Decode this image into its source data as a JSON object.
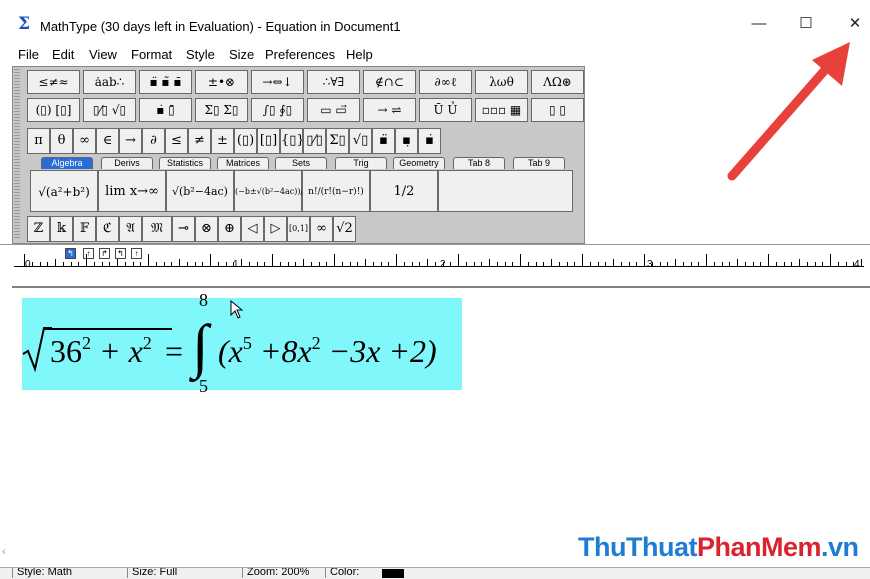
{
  "window": {
    "title": "MathType (30 days left in Evaluation) - Equation in Document1",
    "app_icon": "Σ",
    "minimize": "—",
    "maximize": "☐",
    "close": "✕"
  },
  "menu": [
    "File",
    "Edit",
    "View",
    "Format",
    "Style",
    "Size",
    "Preferences",
    "Help"
  ],
  "toolbar": {
    "row1": [
      "≤≠≈",
      "ȧab∴",
      "▪̈ ▪̃ ▪̄",
      "±•⊗",
      "→⇔↓",
      "∴∀∃",
      "∉∩⊂",
      "∂∞ℓ",
      "λωθ",
      "ΛΩ⊛"
    ],
    "row2": [
      "(▯) [▯]",
      "▯⁄▯ √▯",
      "▪̇ ▯̄",
      "Σ▯ Σ▯",
      "∫▯ ∮▯",
      "▭ ▭⃗",
      "→ ⇌",
      "Ū Ủ",
      "▫▫▫ ▦",
      "▯ ▯"
    ],
    "row3": [
      "π",
      "θ",
      "∞",
      "∈",
      "→",
      "∂",
      "≤",
      "≠",
      "±",
      "(▯)",
      "[▯]",
      "{▯}",
      "▯⁄▯",
      "Σ▯",
      "√▯",
      "▪̈",
      "▪̣",
      "▪̇"
    ],
    "tabs": [
      "Algebra",
      "Derivs",
      "Statistics",
      "Matrices",
      "Sets",
      "Trig",
      "Geometry",
      "Tab 8",
      "Tab 9"
    ],
    "active_tab": "Algebra",
    "algebra_palette": [
      "√(a²+b²)",
      "lim x→∞",
      "√(b²−4ac)",
      "(−b±√(b²−4ac))/2a",
      "n!/(r!(n−r)!)",
      "1/2"
    ],
    "row5": [
      "ℤ",
      "𝕜",
      "𝔽",
      "ℭ",
      "𝔄",
      "𝔐",
      "⊸",
      "⊗",
      "⊕",
      "◁",
      "▷",
      "[0,1]",
      "∞",
      "√2"
    ]
  },
  "ruler": {
    "numbers": [
      "0",
      "1",
      "2",
      "3",
      "4"
    ],
    "tab_stops": [
      "↰",
      "↑",
      "↱",
      "↰",
      "↑"
    ]
  },
  "equation": {
    "lhs_base": "36",
    "lhs_exp": "2",
    "lhs_plus": "+ x",
    "lhs_exp2": "2",
    "equals": "=",
    "integral": "∫",
    "upper_limit": "8",
    "lower_limit": "5",
    "rhs_a": "(x",
    "rhs_a_exp": "5",
    "rhs_b": "+8x",
    "rhs_b_exp": "2",
    "rhs_c": "−3x +2)",
    "highlight_color": "#80f8fb"
  },
  "status": {
    "style": "Style: Math",
    "size": "Size: Full",
    "zoom": "Zoom: 200%",
    "color_label": "Color:",
    "color_value": "#000000"
  },
  "watermark": {
    "part1": "ThuThuat",
    "part2": "PhanMem",
    "part3": ".vn",
    "color1": "#1e7bd6",
    "color2": "#d9232e"
  },
  "annotation": {
    "arrow_color": "#e8413b"
  }
}
